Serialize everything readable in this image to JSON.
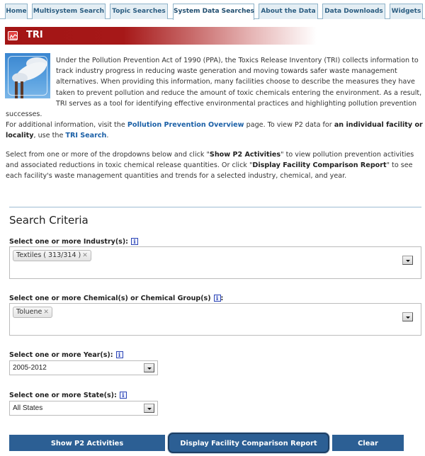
{
  "tabs": [
    {
      "label": "Home",
      "active": false
    },
    {
      "label": "Multisystem Search",
      "active": false
    },
    {
      "label": "Topic Searches",
      "active": false
    },
    {
      "label": "System Data Searches",
      "active": true
    },
    {
      "label": "About the Data",
      "active": false
    },
    {
      "label": "Data Downloads",
      "active": false
    },
    {
      "label": "Widgets",
      "active": false
    }
  ],
  "header": {
    "title": "TRI",
    "icon": "factory-chart-icon",
    "accent_color": "#a31515"
  },
  "intro": {
    "paragraph1": "Under the Pollution Prevention Act of 1990 (PPA), the Toxics Release Inventory (TRI) collects information to track industry progress in reducing waste generation and moving towards safer waste management alternatives. When providing this information, many facilities choose to describe the measures they have taken to prevent pollution and reduce the amount of toxic chemicals entering the environment. As a result, TRI serves as a tool for identifying effective environmental practices and highlighting pollution prevention",
    "paragraph1_tail": "successes.",
    "p2_prefix": "For additional information, visit the ",
    "p2_link1": "Pollution Prevention Overview",
    "p2_middle": " page. To view P2 data for ",
    "p2_bold": "an individual facility or locality",
    "p2_middle2": ", use the ",
    "p2_link2": "TRI Search",
    "p2_suffix": "."
  },
  "instructions": {
    "prefix": "Select from one or more of the dropdowns below and click \"",
    "bold1": "Show P2 Activities",
    "middle": "\" to view pollution prevention activities and associated reductions in toxic chemical release quantities. Or click \"",
    "bold2": "Display Facility Comparison Report",
    "suffix": "\" to see each facility's waste management quantities and trends for a selected industry, chemical, and year."
  },
  "search": {
    "title": "Search Criteria",
    "industry_label": "Select one or more Industry(s):",
    "industry_selected": "Textiles ( 313/314 )",
    "chemical_label": "Select one or more Chemical(s) or Chemical Group(s)",
    "chemical_label_suffix": ":",
    "chemical_selected": "Toluene",
    "year_label": "Select one or more Year(s):",
    "year_value": "2005-2012",
    "state_label": "Select one or more State(s):",
    "state_value": "All States",
    "info_glyph": "i",
    "remove_glyph": "✕"
  },
  "buttons": {
    "show_p2": "Show P2 Activities",
    "display_report": "Display Facility Comparison Report",
    "clear": "Clear",
    "color": "#2c5f94"
  }
}
